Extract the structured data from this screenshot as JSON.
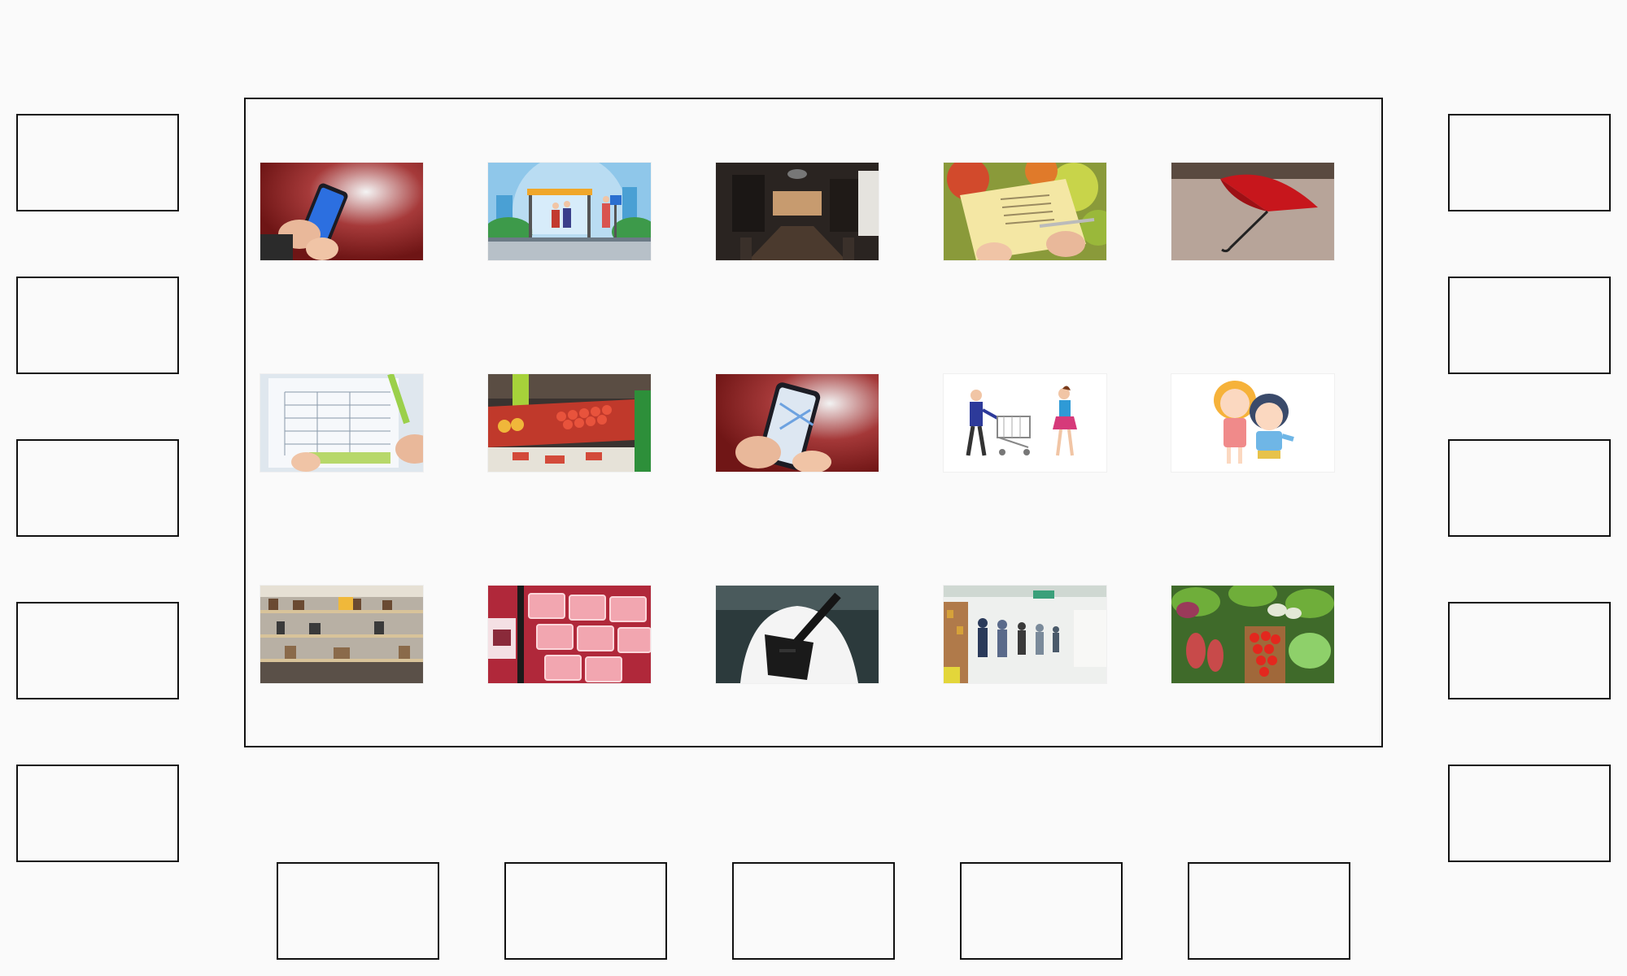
{
  "board": {
    "name": "picture-board"
  },
  "cards": [
    {
      "id": "card-phone-blue-screen",
      "icon": "smartphone-blue-screen-photo"
    },
    {
      "id": "card-bus-stop",
      "icon": "bus-stop-illustration"
    },
    {
      "id": "card-dining-room",
      "icon": "dining-room-photo"
    },
    {
      "id": "card-shopping-list",
      "icon": "shopping-list-photo"
    },
    {
      "id": "card-red-umbrella",
      "icon": "red-umbrella-photo"
    },
    {
      "id": "card-paper-checklist",
      "icon": "paper-checklist-photo"
    },
    {
      "id": "card-fruit-aisle",
      "icon": "fruit-aisle-photo"
    },
    {
      "id": "card-phone-map",
      "icon": "smartphone-map-photo"
    },
    {
      "id": "card-shoppers-cart",
      "icon": "shoppers-with-cart-illustration"
    },
    {
      "id": "card-children",
      "icon": "children-cartoon-illustration"
    },
    {
      "id": "card-store-shelves",
      "icon": "store-shelves-photo"
    },
    {
      "id": "card-meat-counter",
      "icon": "meat-counter-photo"
    },
    {
      "id": "card-crossbody-bag",
      "icon": "crossbody-bag-photo"
    },
    {
      "id": "card-checkout-queue",
      "icon": "checkout-queue-photo"
    },
    {
      "id": "card-vegetable-stand",
      "icon": "vegetable-stand-photo"
    }
  ],
  "slots": {
    "left_count": 5,
    "right_count": 5,
    "bottom_count": 5
  },
  "colors": {
    "background": "#fafafa",
    "border": "#111111"
  }
}
